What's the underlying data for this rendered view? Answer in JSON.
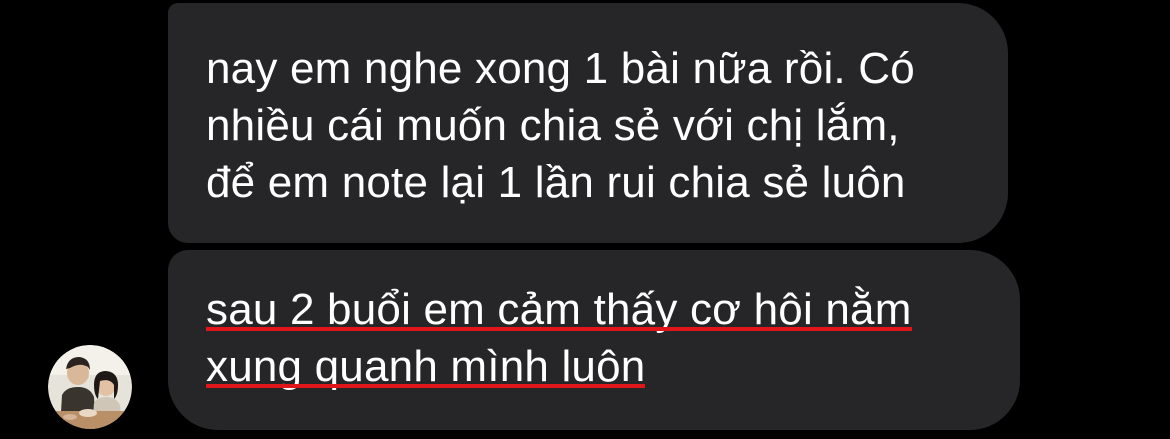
{
  "theme": {
    "background": "#000000",
    "bubble_color": "#262628",
    "text_color": "#ffffff",
    "annotation_color": "#e0161b"
  },
  "messages": [
    {
      "lines": [
        "nay em nghe xong 1 bài nữa rồi. Có",
        "nhiều cái muốn chia sẻ với chị lắm,",
        "để em note lại 1 lần rui chia sẻ luôn"
      ]
    },
    {
      "lines": [
        "sau 2 buổi em cảm thấy cơ hội nằm",
        "xung quanh mình luôn"
      ],
      "underlined": true
    }
  ],
  "sender": {
    "avatar_icon": "profile-photo-avatar"
  }
}
